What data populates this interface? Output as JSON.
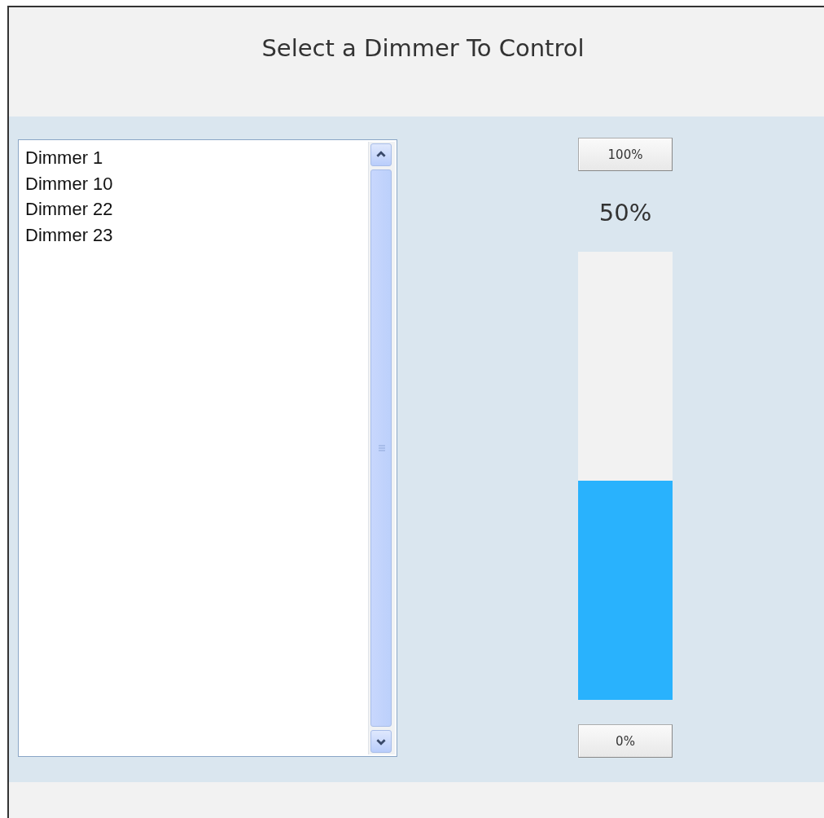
{
  "header": {
    "title": "Select a Dimmer To Control"
  },
  "dimmers": [
    {
      "label": "Dimmer 1",
      "selected": false
    },
    {
      "label": "Dimmer 10",
      "selected": false
    },
    {
      "label": "Dimmer 22",
      "selected": false
    },
    {
      "label": "Dimmer 23",
      "selected": false
    }
  ],
  "control": {
    "max_button": "100%",
    "reading": "50%",
    "level": 0.49,
    "min_button": "0%"
  }
}
